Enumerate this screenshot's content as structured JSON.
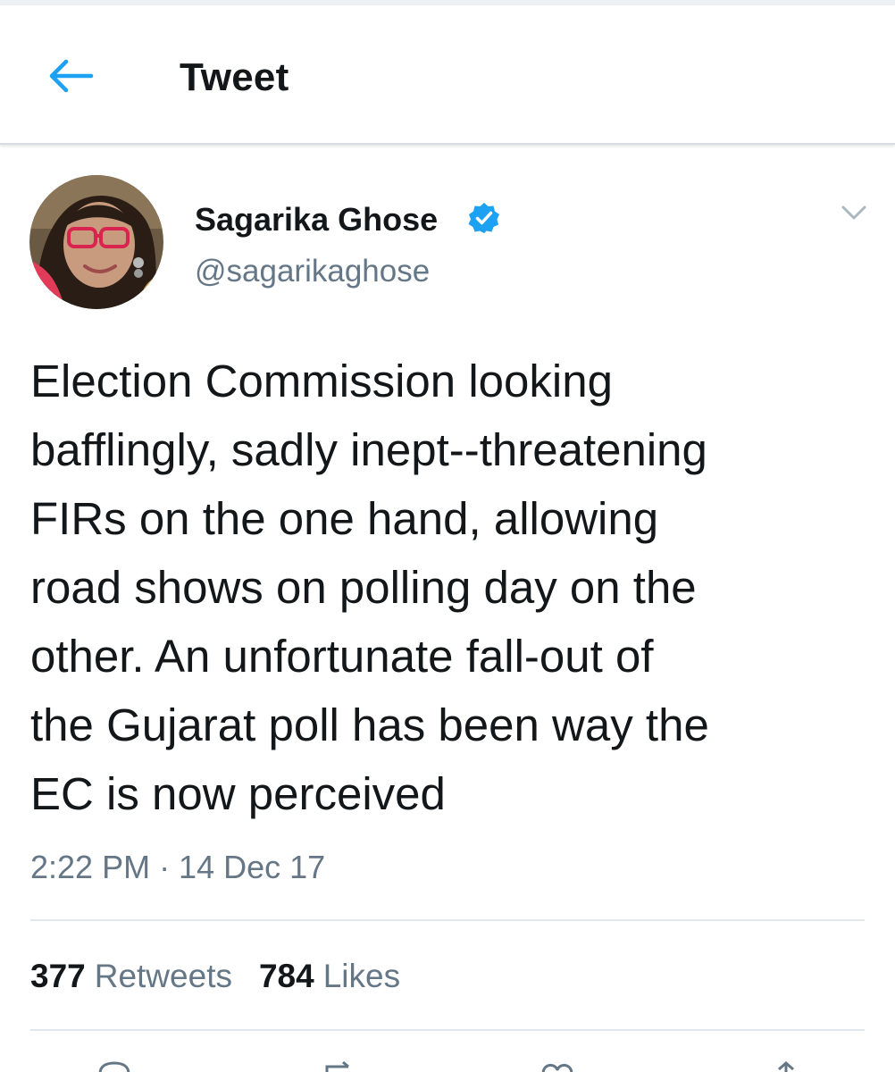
{
  "header": {
    "title": "Tweet",
    "back_icon": "arrow-left-icon",
    "accent_color": "#1da1f2"
  },
  "author": {
    "display_name": "Sagarika Ghose",
    "handle": "@sagarikaghose",
    "verified": true,
    "verified_icon": "verified-badge-icon",
    "menu_icon": "chevron-down-icon"
  },
  "tweet": {
    "text_lines": [
      "Election Commission looking",
      "bafflingly, sadly inept--threatening",
      "FIRs on the one hand, allowing",
      "road shows on polling day on the",
      "other. An unfortunate fall-out of",
      "the Gujarat poll has been way the",
      "EC is now perceived"
    ],
    "timestamp": "2:22 PM · 14 Dec 17"
  },
  "stats": {
    "retweets_count": "377",
    "retweets_label": "Retweets",
    "likes_count": "784",
    "likes_label": "Likes"
  },
  "actions": [
    "reply-icon",
    "retweet-icon",
    "like-icon",
    "share-icon"
  ]
}
